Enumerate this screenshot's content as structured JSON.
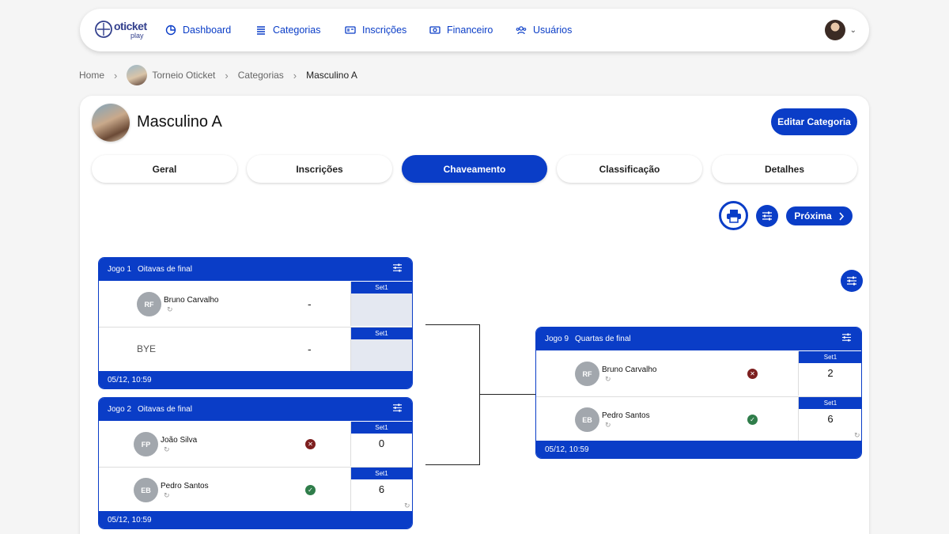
{
  "nav": {
    "logo_main": "oticket",
    "logo_sub": "play",
    "items": [
      {
        "label": "Dashboard",
        "icon": "chart-pie-icon"
      },
      {
        "label": "Categorias",
        "icon": "list-icon"
      },
      {
        "label": "Inscrições",
        "icon": "id-card-icon"
      },
      {
        "label": "Financeiro",
        "icon": "money-icon"
      },
      {
        "label": "Usuários",
        "icon": "users-icon"
      }
    ],
    "accent": "#0a3dc7"
  },
  "breadcrumb": {
    "home": "Home",
    "tournament": "Torneio Oticket",
    "categories": "Categorias",
    "current": "Masculino A"
  },
  "category": {
    "title": "Masculino A",
    "edit_label": "Editar Categoria"
  },
  "tabs": [
    {
      "label": "Geral",
      "active": false
    },
    {
      "label": "Inscrições",
      "active": false
    },
    {
      "label": "Chaveamento",
      "active": true
    },
    {
      "label": "Classificação",
      "active": false
    },
    {
      "label": "Detalhes",
      "active": false
    }
  ],
  "toolbar": {
    "next_label": "Próxima"
  },
  "matches": {
    "m1": {
      "game": "Jogo 1",
      "round": "Oitavas de final",
      "date": "05/12, 10:59",
      "p1": {
        "initials": "RF",
        "name": "Bruno Carvalho",
        "score_marker": "-",
        "set_label": "Set1",
        "set_value": ""
      },
      "p2": {
        "name": "BYE",
        "score_marker": "-",
        "set_label": "Set1",
        "set_value": ""
      }
    },
    "m2": {
      "game": "Jogo 2",
      "round": "Oitavas de final",
      "date": "05/12, 10:59",
      "p1": {
        "initials": "FP",
        "name": "João Silva",
        "set_label": "Set1",
        "set_value": "0",
        "result": "loss"
      },
      "p2": {
        "initials": "EB",
        "name": "Pedro Santos",
        "set_label": "Set1",
        "set_value": "6",
        "result": "win"
      }
    },
    "m9": {
      "game": "Jogo 9",
      "round": "Quartas de final",
      "date": "05/12, 10:59",
      "p1": {
        "initials": "RF",
        "name": "Bruno Carvalho",
        "set_label": "Set1",
        "set_value": "2",
        "result": "loss"
      },
      "p2": {
        "initials": "EB",
        "name": "Pedro Santos",
        "set_label": "Set1",
        "set_value": "6",
        "result": "win"
      }
    }
  }
}
